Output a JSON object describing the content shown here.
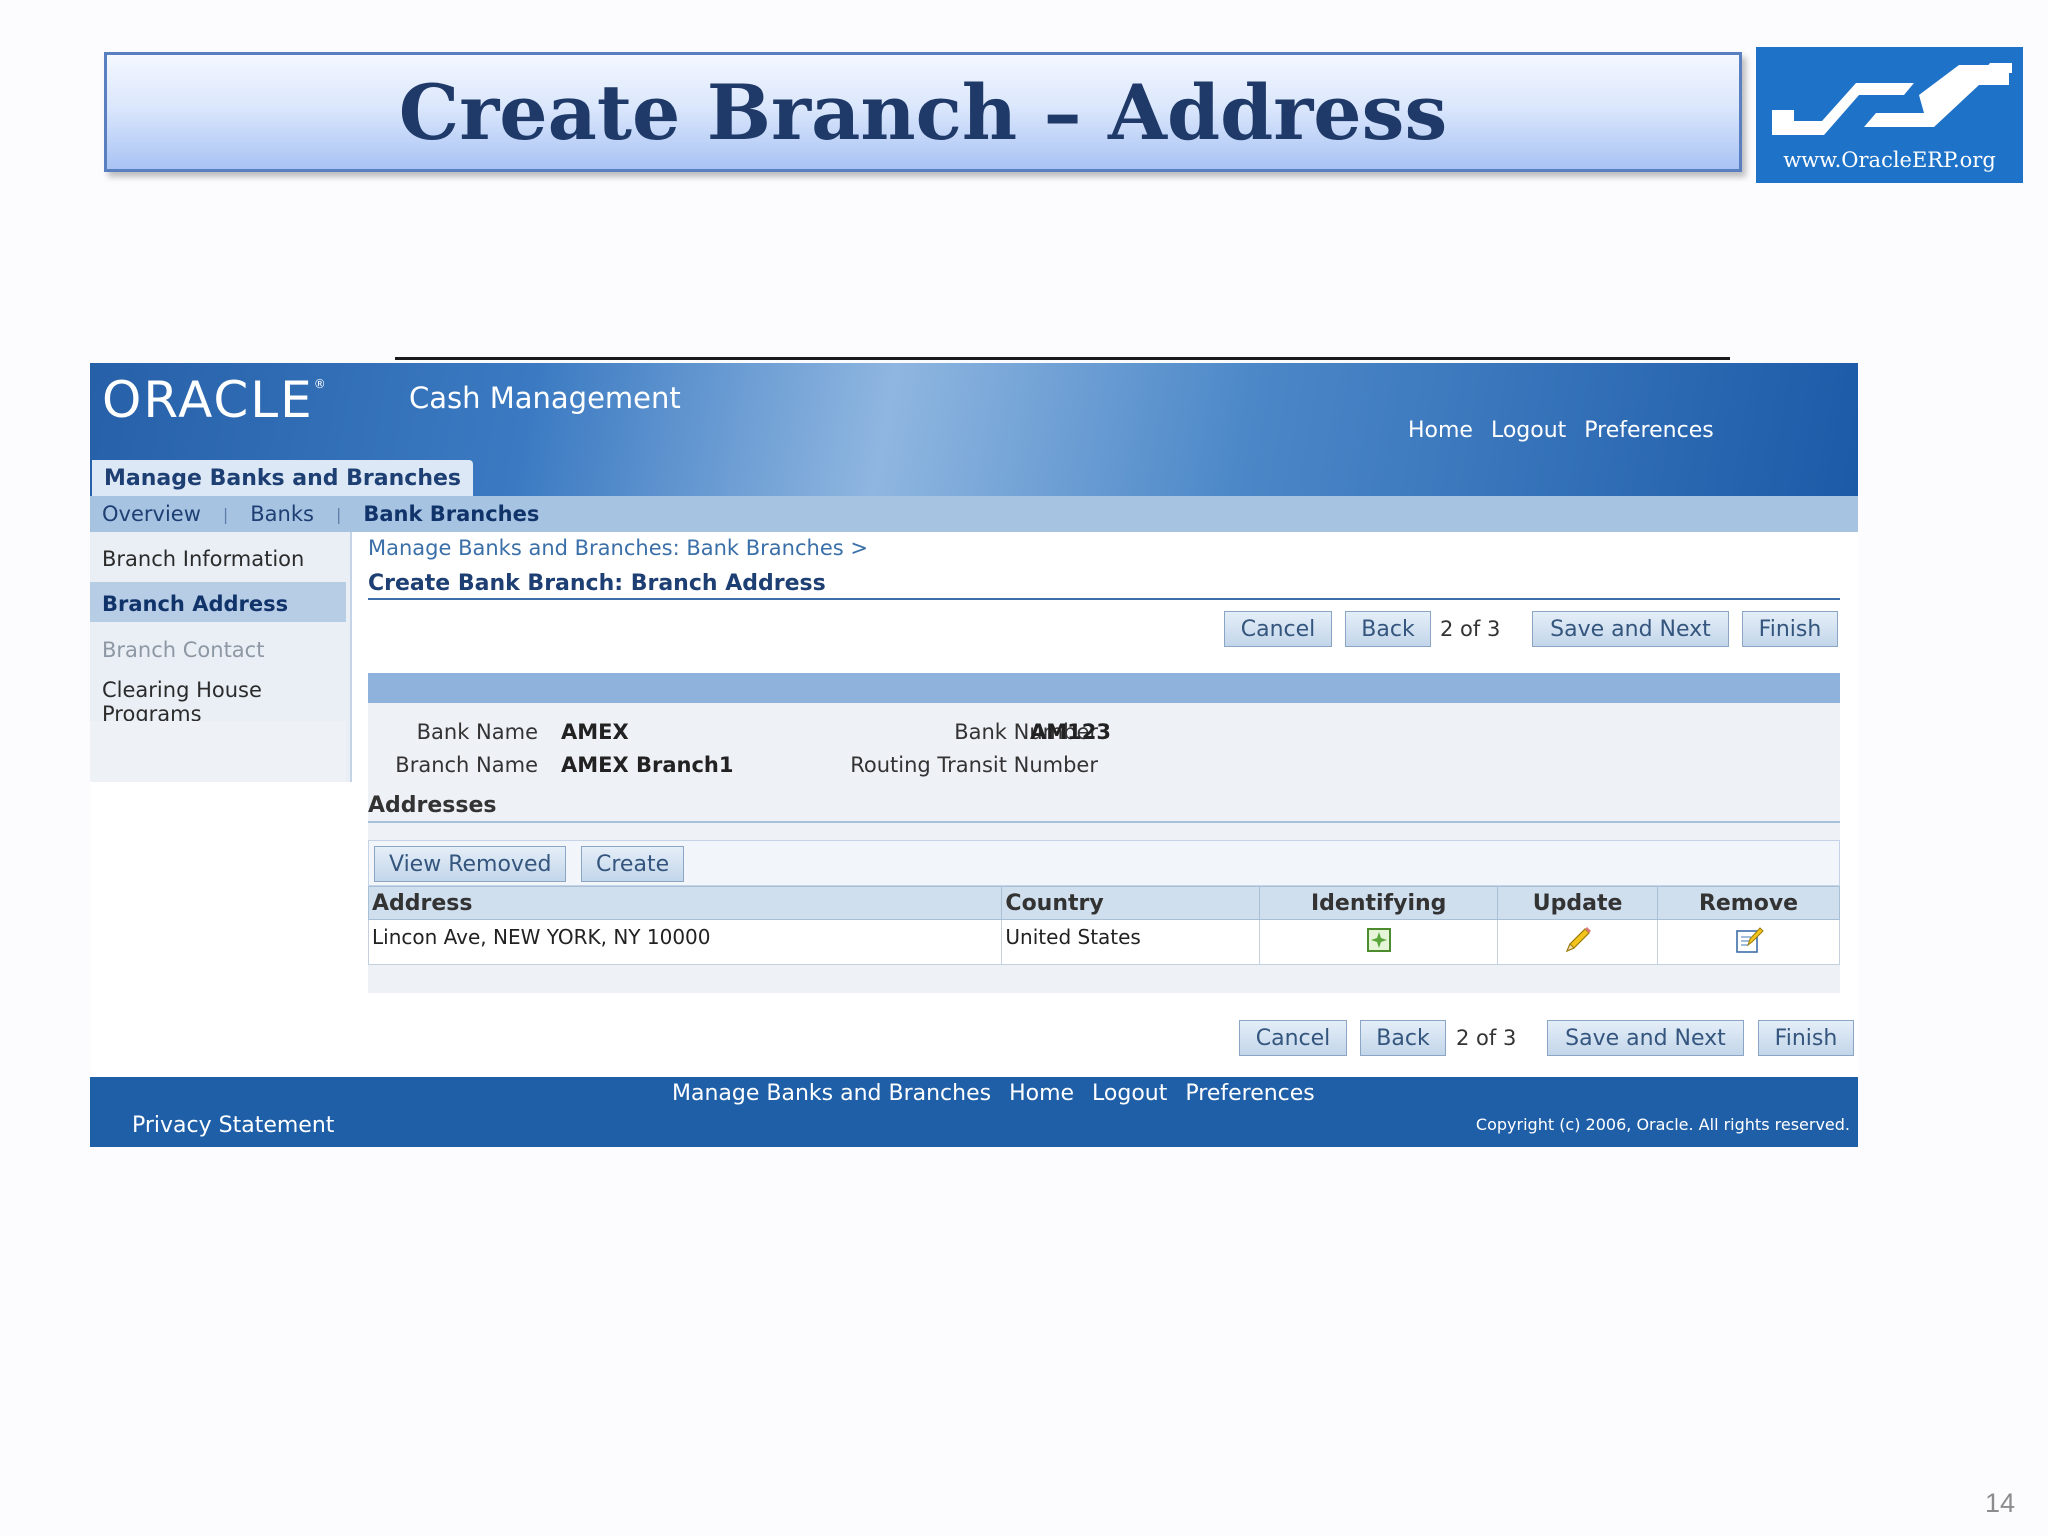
{
  "slide": {
    "title": "Create Branch – Address",
    "logo_url_text": "www.OracleERP.org",
    "page_number": "14"
  },
  "app": {
    "brand": "ORACLE",
    "product": "Cash Management",
    "global_links": [
      "Home",
      "Logout",
      "Preferences"
    ],
    "main_tab": "Manage Banks and Branches",
    "subnav": [
      "Overview",
      "Banks",
      "Bank Branches"
    ],
    "subnav_active": "Bank Branches"
  },
  "sidenav": {
    "items": [
      "Branch Information",
      "Branch Address",
      "Branch Contact",
      "Clearing House Programs"
    ],
    "clearing_line1": "Clearing House",
    "clearing_line2": "Programs"
  },
  "content": {
    "breadcrumb": "Manage Banks and Branches: Bank Branches  >",
    "heading": "Create Bank Branch: Branch Address",
    "buttons": {
      "cancel": "Cancel",
      "back": "Back",
      "save_next": "Save and Next",
      "finish": "Finish"
    },
    "step": "2 of 3",
    "fields": {
      "bank_name_label": "Bank Name",
      "bank_name": "AMEX",
      "branch_name_label": "Branch Name",
      "branch_name": "AMEX Branch1",
      "bank_number_label": "Bank Number",
      "bank_number": "AM123",
      "routing_label": "Routing Transit Number",
      "routing": ""
    },
    "addresses_title": "Addresses",
    "table_buttons": [
      "View Removed",
      "Create"
    ],
    "columns": [
      "Address",
      "Country",
      "Identifying",
      "Update",
      "Remove"
    ],
    "rows": [
      {
        "address": "Lincon Ave, NEW YORK, NY 10000",
        "country": "United States"
      }
    ]
  },
  "footer": {
    "links": [
      "Manage Banks and Branches",
      "Home",
      "Logout",
      "Preferences"
    ],
    "privacy": "Privacy Statement",
    "copyright": "Copyright (c) 2006, Oracle. All rights reserved."
  },
  "colors": {
    "title_text": "#1f3a68",
    "header_blue": "#1f5fa8",
    "accent_light": "#a7c3e2"
  }
}
